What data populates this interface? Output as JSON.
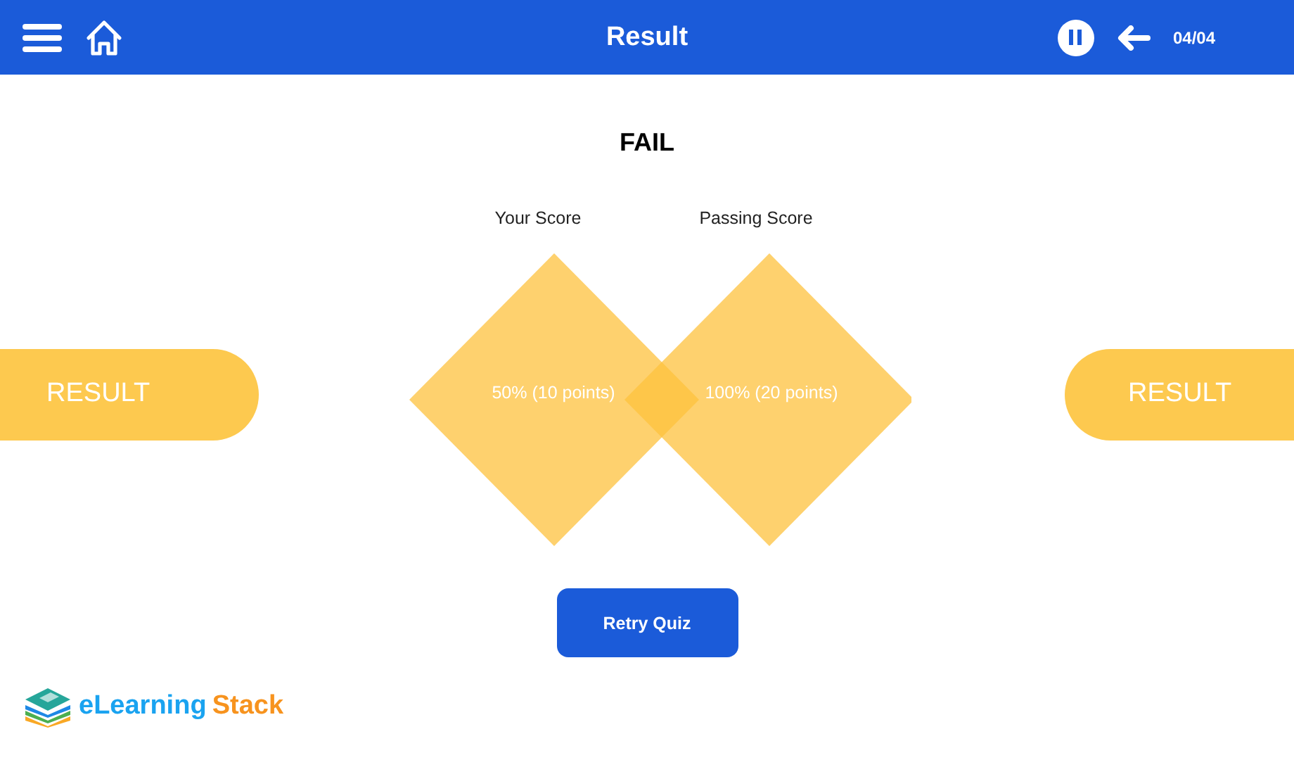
{
  "header": {
    "title": "Result",
    "counter": "04/04"
  },
  "result": {
    "heading": "FAIL",
    "side_label_left": "RESULT",
    "side_label_right": "RESULT",
    "scores": [
      {
        "label": "Your Score",
        "value": "50% (10 points)"
      },
      {
        "label": "Passing Score",
        "value": "100% (20 points)"
      }
    ],
    "retry_button": "Retry Quiz"
  },
  "logo": {
    "first": "eLearning",
    "second": "Stack"
  }
}
